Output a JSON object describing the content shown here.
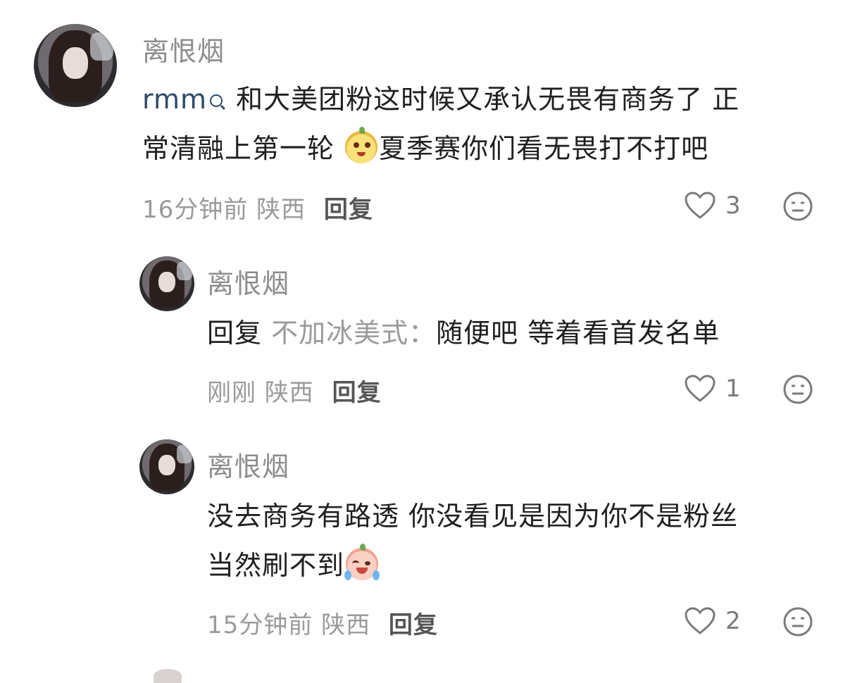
{
  "comments": [
    {
      "username": "离恨烟",
      "mention": "rmm",
      "text_line1": "和大美团粉这时候又承认无畏有商务了 正",
      "text_line2a": "常清融上第一轮 ",
      "text_line2b": "夏季赛你们看无畏打不打吧",
      "time": "16分钟前",
      "location": "陕西",
      "reply_label": "回复",
      "likes": "3"
    },
    {
      "username": "离恨烟",
      "reply_prefix": "回复",
      "reply_target": "不加冰美式：",
      "text": "随便吧 等着看首发名单",
      "time": "刚刚",
      "location": "陕西",
      "reply_label": "回复",
      "likes": "1"
    },
    {
      "username": "离恨烟",
      "text_line1": "没去商务有路透 你没看见是因为你不是粉丝",
      "text_line2": "当然刷不到",
      "time": "15分钟前",
      "location": "陕西",
      "reply_label": "回复",
      "likes": "2"
    }
  ],
  "icons": {
    "like": "heart-outline-icon",
    "dislike": "neutral-face-icon",
    "emoji1": "laughing-peach-emoji",
    "emoji2": "crying-peach-emoji"
  }
}
